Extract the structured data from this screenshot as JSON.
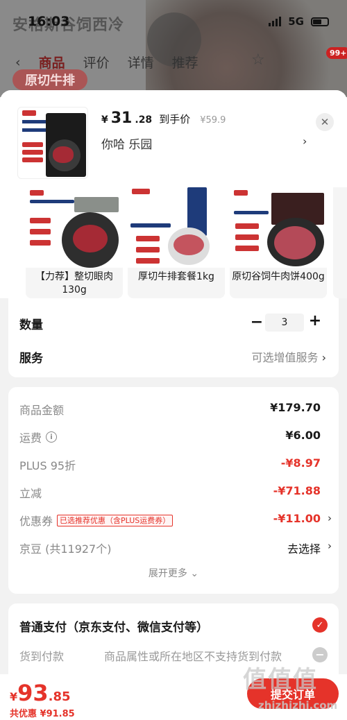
{
  "status_bar": {
    "time": "16:03",
    "network": "5G"
  },
  "background_page": {
    "title": "安格斯谷饲西冷",
    "tabs": [
      "商品",
      "评价",
      "详情",
      "推荐"
    ],
    "badge": "99+",
    "chip": "原切牛排"
  },
  "product": {
    "currency": "¥",
    "price_int": "31",
    "price_dec": ".28",
    "price_tag": "到手价",
    "original_price": "¥59.9",
    "variant": "你哈  乐园",
    "close_icon": "close-icon"
  },
  "options_cards": [
    {
      "label": "【力荐】整切眼肉130g"
    },
    {
      "label": "厚切牛排套餐1kg"
    },
    {
      "label": "原切谷饲牛肉饼400g"
    }
  ],
  "quantity": {
    "label": "数量",
    "value": "3"
  },
  "service": {
    "label": "服务",
    "value": "可选增值服务"
  },
  "breakdown": {
    "items": [
      {
        "label": "商品金额",
        "value": "¥179.70",
        "red": false
      },
      {
        "label": "运费",
        "value": "¥6.00",
        "red": false
      },
      {
        "label": "PLUS 95折",
        "value": "-¥8.97",
        "red": true
      },
      {
        "label": "立减",
        "value": "-¥71.88",
        "red": true
      },
      {
        "label": "优惠券",
        "tag": "已选推荐优惠（含PLUS运费券）",
        "value": "-¥11.00",
        "red": true
      },
      {
        "label": "京豆 (共11927个)",
        "value": "去选择",
        "red": false
      }
    ],
    "expand_label": "展开更多 ⌄"
  },
  "payment": {
    "main": "普通支付（京东支付、微信支付等）",
    "cod": "货到付款",
    "cod_note": "商品属性或所在地区不支持货到付款"
  },
  "bottom": {
    "currency": "¥",
    "total_int": "93",
    "total_dec": ".85",
    "saving": "共优惠 ¥91.85",
    "submit": "提交订单"
  },
  "watermark": {
    "main": "值值值",
    "sub": "zhizhizhi.com"
  },
  "colors": {
    "accent": "#e5332a"
  }
}
